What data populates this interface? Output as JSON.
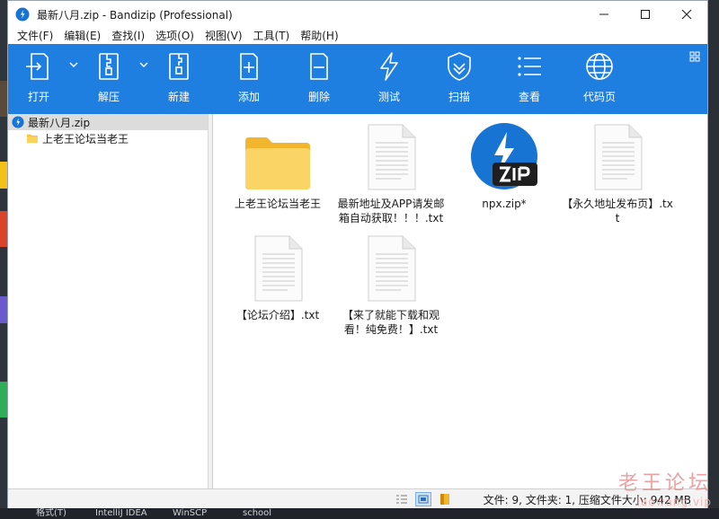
{
  "window": {
    "title": "最新八月.zip - Bandizip (Professional)"
  },
  "menu": [
    "文件(F)",
    "编辑(E)",
    "查找(I)",
    "选项(O)",
    "视图(V)",
    "工具(T)",
    "帮助(H)"
  ],
  "toolbar": {
    "open": "打开",
    "extract": "解压",
    "new": "新建",
    "add": "添加",
    "delete": "删除",
    "test": "测试",
    "scan": "扫描",
    "view": "查看",
    "codepage": "代码页"
  },
  "tree": {
    "root": "最新八月.zip",
    "child": "上老王论坛当老王"
  },
  "files": [
    {
      "name": "上老王论坛当老王",
      "icon": "folder-icon"
    },
    {
      "name": "最新地址及APP请发邮箱自动获取！！！.txt",
      "icon": "text-file-icon"
    },
    {
      "name": "npx.zip*",
      "icon": "bandizip-zip-icon"
    },
    {
      "name": "【永久地址发布页】.txt",
      "icon": "text-file-icon"
    },
    {
      "name": "【论坛介绍】.txt",
      "icon": "text-file-icon"
    },
    {
      "name": "【来了就能下载和观看！纯免费！】.txt",
      "icon": "text-file-icon"
    }
  ],
  "status": {
    "text": "文件: 9, 文件夹: 1, 压缩文件大小: 942 MB"
  },
  "watermark": {
    "line1": "老王论坛",
    "line2": "laowang.vip"
  },
  "taskbar": [
    "格式(T)",
    "IntelliJ IDEA",
    "WinSCP",
    "school"
  ],
  "colors": {
    "toolbar": "#1e7fe0",
    "folder": "#f6c343",
    "zip_icon": "#1874d2"
  }
}
